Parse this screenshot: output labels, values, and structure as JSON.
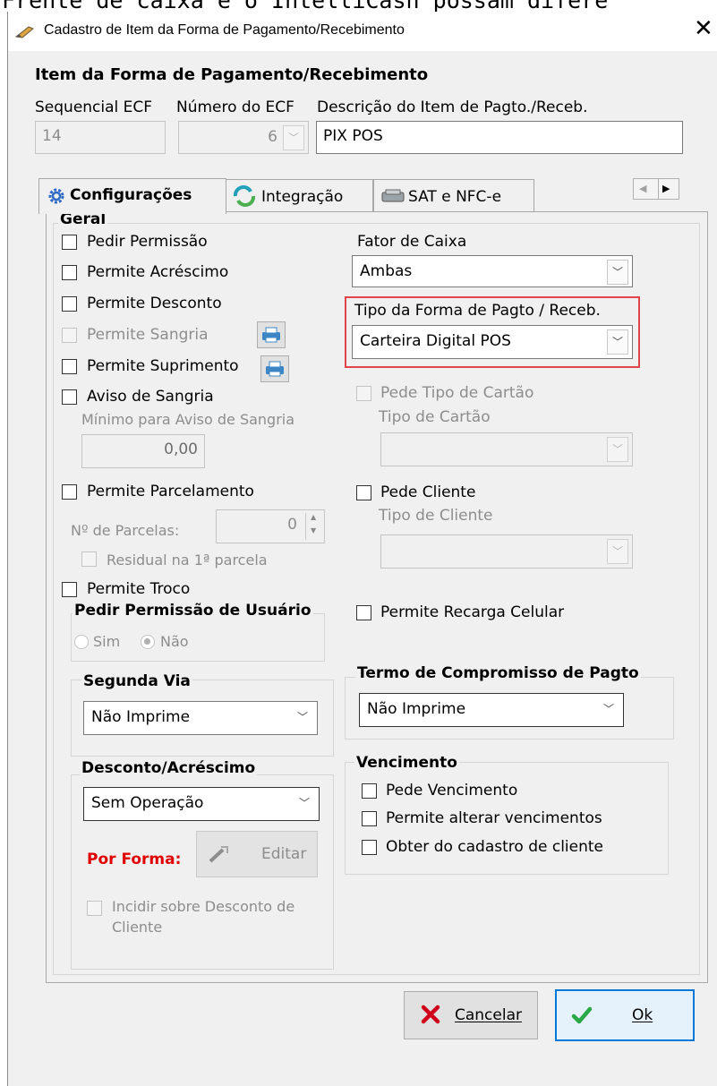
{
  "background_text": "Frente de caixa e o IntelliCash possam difere",
  "window": {
    "title": "Cadastro de Item da Forma de Pagamento/Recebimento",
    "close_glyph": "✕",
    "icon": "pencil-app-icon"
  },
  "header": {
    "section_title": "Item da Forma de Pagamento/Recebimento",
    "seq_label": "Sequencial ECF",
    "seq_value": "14",
    "num_label": "Número do ECF",
    "num_value": "6",
    "desc_label": "Descrição do Item de Pagto./Receb.",
    "desc_value": "PIX POS"
  },
  "tabs": [
    {
      "label": "Configurações",
      "icon": "gear-icon",
      "active": true
    },
    {
      "label": "Integração",
      "icon": "sync-icon",
      "active": false
    },
    {
      "label": "SAT e NFC-e",
      "icon": "printer-icon",
      "active": false
    }
  ],
  "geral": {
    "title": "Geral",
    "pedir_permissao": "Pedir Permissão",
    "permite_acrescimo": "Permite Acréscimo",
    "permite_desconto": "Permite Desconto",
    "permite_sangria": "Permite Sangria",
    "permite_suprimento": "Permite Suprimento",
    "aviso_sangria": "Aviso de Sangria",
    "minimo_aviso_label": "Mínimo para Aviso de Sangria",
    "minimo_aviso_value": "0,00",
    "permite_parcelamento": "Permite Parcelamento",
    "num_parcelas_label": "Nº de Parcelas:",
    "num_parcelas_value": "0",
    "residual": "Residual na 1ª parcela",
    "permite_troco": "Permite Troco"
  },
  "pedir_permissao_usuario": {
    "title": "Pedir Permissão de Usuário",
    "sim": "Sim",
    "nao": "Não",
    "selected": "Não"
  },
  "segunda_via": {
    "title": "Segunda Via",
    "value": "Não Imprime"
  },
  "desconto_acrescimo": {
    "title": "Desconto/Acréscimo",
    "value": "Sem Operação",
    "por_forma": "Por Forma:",
    "editar": "Editar",
    "incidir_line1": "Incidir sobre Desconto de",
    "incidir_line2": "Cliente"
  },
  "right": {
    "fator_caixa_label": "Fator de Caixa",
    "fator_caixa_value": "Ambas",
    "tipo_forma_label": "Tipo da Forma de Pagto / Receb.",
    "tipo_forma_value": "Carteira Digital POS",
    "pede_tipo_cartao": "Pede Tipo de Cartão",
    "tipo_cartao_label": "Tipo de Cartão",
    "pede_cliente": "Pede Cliente",
    "tipo_cliente_label": "Tipo de Cliente",
    "permite_recarga": "Permite Recarga Celular"
  },
  "termo": {
    "title": "Termo de Compromisso de Pagto",
    "value": "Não Imprime"
  },
  "vencimento": {
    "title": "Vencimento",
    "pede_vencimento": "Pede Vencimento",
    "permite_alterar": "Permite alterar vencimentos",
    "obter_cadastro": "Obter do cadastro de cliente"
  },
  "buttons": {
    "cancelar": "Cancelar",
    "ok": "Ok"
  },
  "colors": {
    "highlight_border": "#e0454a",
    "por_forma": "#e00000",
    "cancel_icon": "#d0021b",
    "ok_icon": "#2aa845",
    "ok_border": "#0078d7"
  }
}
